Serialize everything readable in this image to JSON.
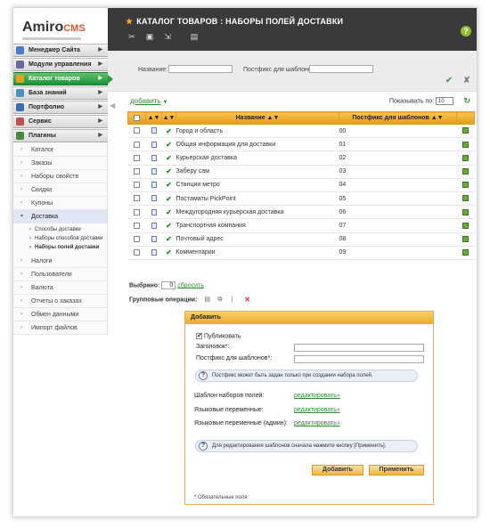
{
  "header": {
    "logo_main": "Amiro",
    "logo_cms": "CMS",
    "title": "КАТАЛОГ ТОВАРОВ : НАБОРЫ ПОЛЕЙ ДОСТАВКИ",
    "help": "?"
  },
  "filter": {
    "name_label": "Название:",
    "postfix_label": "Постфикс для шаблонов:",
    "name_value": "",
    "postfix_value": ""
  },
  "sidebar": {
    "menu": [
      {
        "label": "Менеджер Сайта",
        "color": "#4a7bd0"
      },
      {
        "label": "Модули управления",
        "color": "#6a6aa0"
      },
      {
        "label": "Каталог товаров",
        "color": "#e8a020",
        "active": true
      },
      {
        "label": "База знаний",
        "color": "#4a90c0"
      },
      {
        "label": "Портфолио",
        "color": "#3a70b0"
      },
      {
        "label": "Сервис",
        "color": "#c05050"
      },
      {
        "label": "Плагины",
        "color": "#4a8a40"
      }
    ],
    "catalog_items": [
      "Каталог",
      "Заказы",
      "Наборы свойств",
      "Скидки",
      "Купоны",
      "Доставка"
    ],
    "delivery_sub": [
      "Способы доставки",
      "Наборы способов доставки",
      "Наборы полей доставки"
    ],
    "after_items": [
      "Налоги",
      "Пользователи",
      "Валюта",
      "Отчеты о заказах",
      "Обмен данными",
      "Импорт файлов"
    ]
  },
  "toolbar": {
    "add": "добавить",
    "show_by_label": "Показывать по:",
    "show_by_value": "10"
  },
  "table": {
    "col_name": "Название",
    "col_postfix": "Постфикс для шаблонов",
    "rows": [
      {
        "name": "Город и область",
        "postfix": "00"
      },
      {
        "name": "Общая информация для доставки",
        "postfix": "01"
      },
      {
        "name": "Курьерская доставка",
        "postfix": "02"
      },
      {
        "name": "Заберу сам",
        "postfix": "03"
      },
      {
        "name": "Станции метро",
        "postfix": "04"
      },
      {
        "name": "Постаматы PickPoint",
        "postfix": "05"
      },
      {
        "name": "Междугородняя курьерская доставка",
        "postfix": "06"
      },
      {
        "name": "Транспортная компания",
        "postfix": "07"
      },
      {
        "name": "Почтовый адрес",
        "postfix": "08"
      },
      {
        "name": "Комментарии",
        "postfix": "09"
      }
    ]
  },
  "selection": {
    "selected_label": "Выбрано:",
    "selected_count": "0",
    "reset": "сбросить",
    "group_ops": "Групповые операции:"
  },
  "dialog": {
    "title": "Добавить",
    "publish": "Публиковать",
    "heading_label": "Заголовок*:",
    "postfix_label": "Постфикс для шаблонов*:",
    "note1": "Постфикс может быть задан только при создании набора полей.",
    "tpl_label": "Шаблон наборов полей:",
    "lang_label": "Языковые переменные:",
    "lang_admin_label": "Языковые переменные (админ):",
    "edit": "редактировать»",
    "note2": "Для редактирования шаблонов сначала нажмите кнопку [Применить].",
    "add_btn": "Добавить",
    "apply_btn": "Применить",
    "required": "* Обязательные поля"
  }
}
